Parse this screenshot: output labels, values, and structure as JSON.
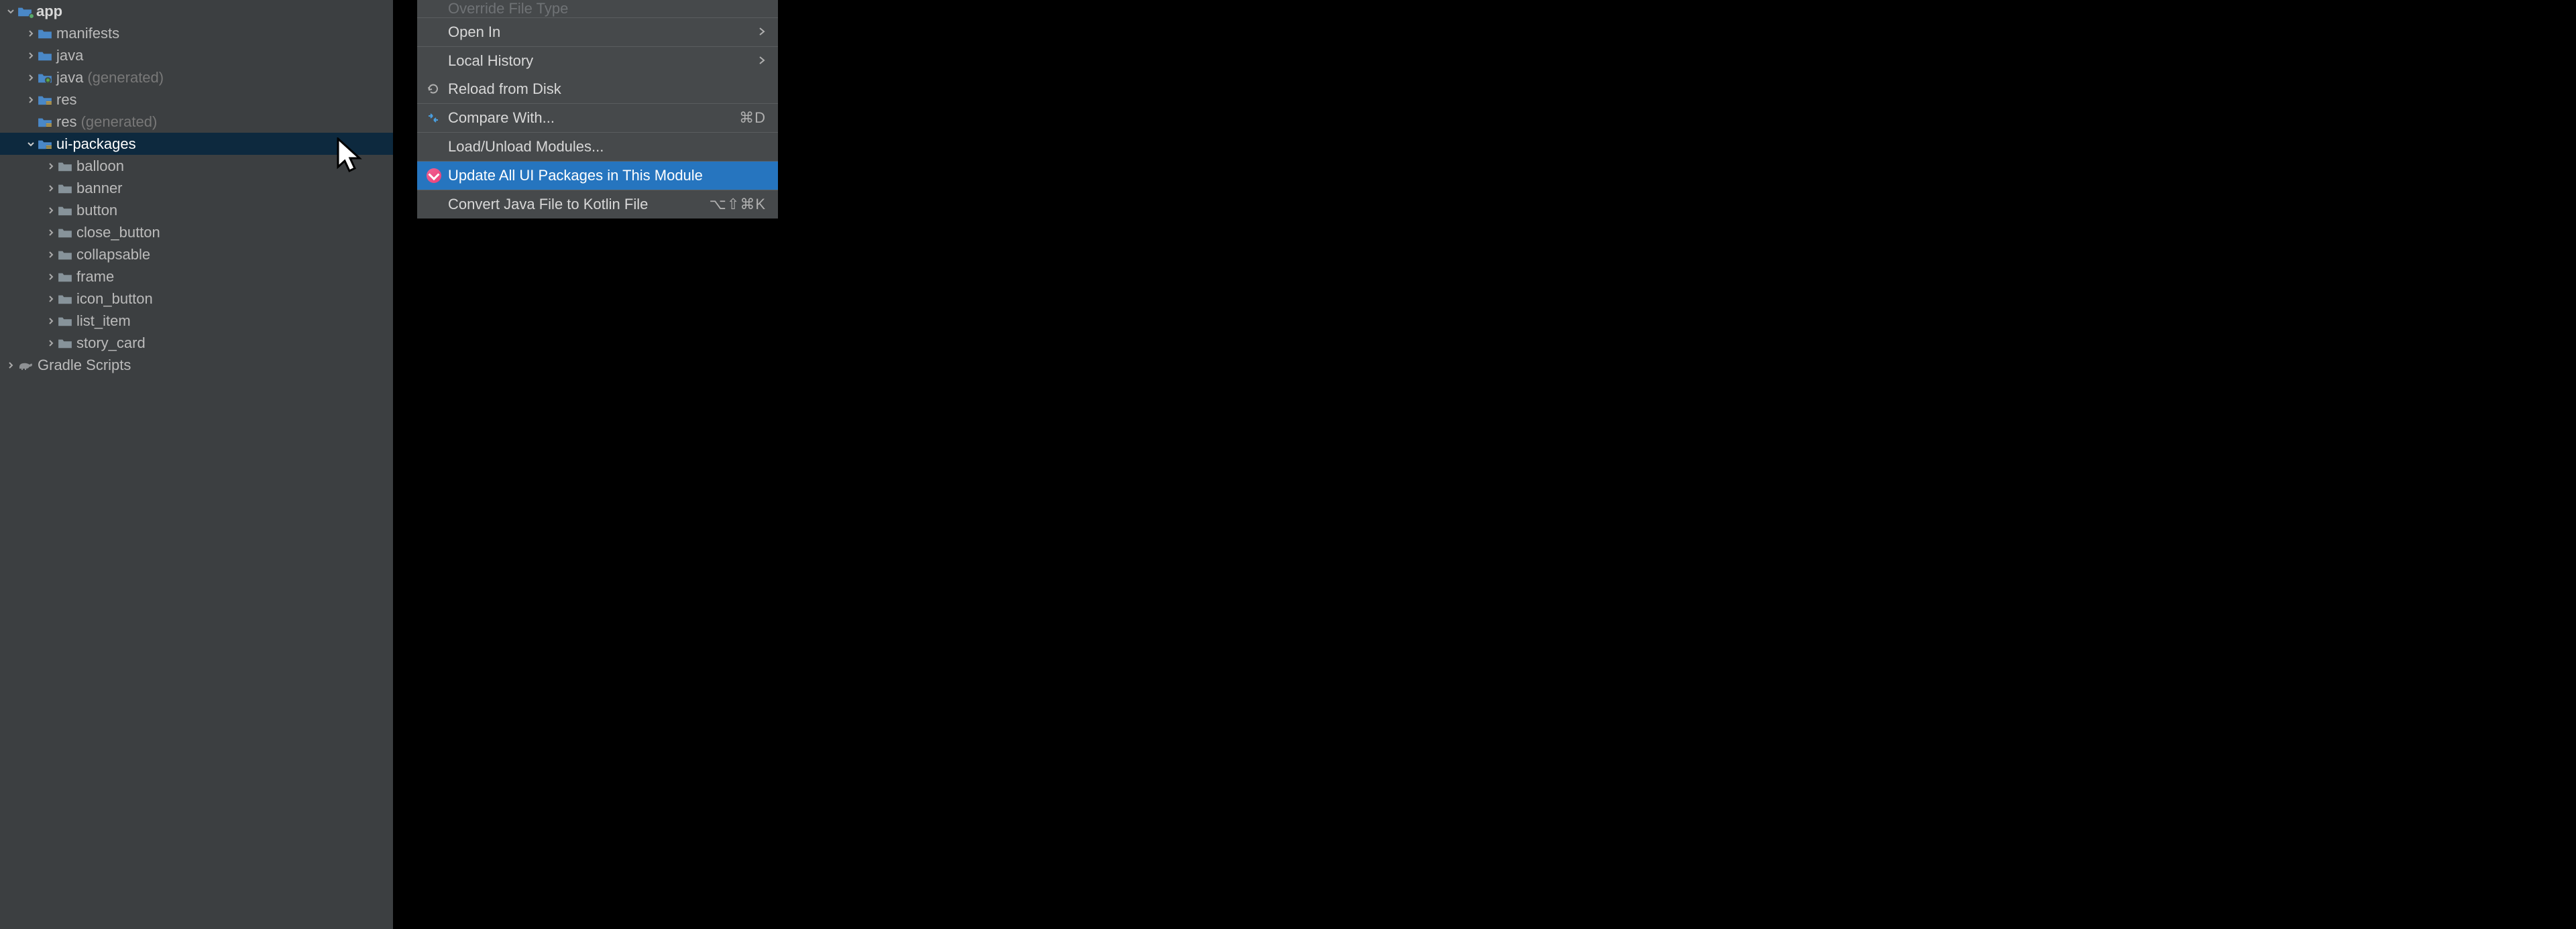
{
  "tree": {
    "app": "app",
    "manifests": "manifests",
    "java": "java",
    "java_gen": "java",
    "generated": "(generated)",
    "res": "res",
    "res_gen": "res",
    "ui_packages": "ui-packages",
    "items": {
      "balloon": "balloon",
      "banner": "banner",
      "button": "button",
      "close_button": "close_button",
      "collapsable": "collapsable",
      "frame": "frame",
      "icon_button": "icon_button",
      "list_item": "list_item",
      "story_card": "story_card"
    },
    "gradle": "Gradle Scripts"
  },
  "menu": {
    "override_file_type": "Override File Type",
    "open_in": "Open In",
    "local_history": "Local History",
    "reload_disk": "Reload from Disk",
    "compare_with": "Compare With...",
    "compare_with_shortcut": "⌘D",
    "load_unload": "Load/Unload Modules...",
    "update_ui": "Update All UI Packages in This Module",
    "convert_kotlin": "Convert Java File to Kotlin File",
    "convert_kotlin_shortcut": "⌥⇧⌘K"
  }
}
